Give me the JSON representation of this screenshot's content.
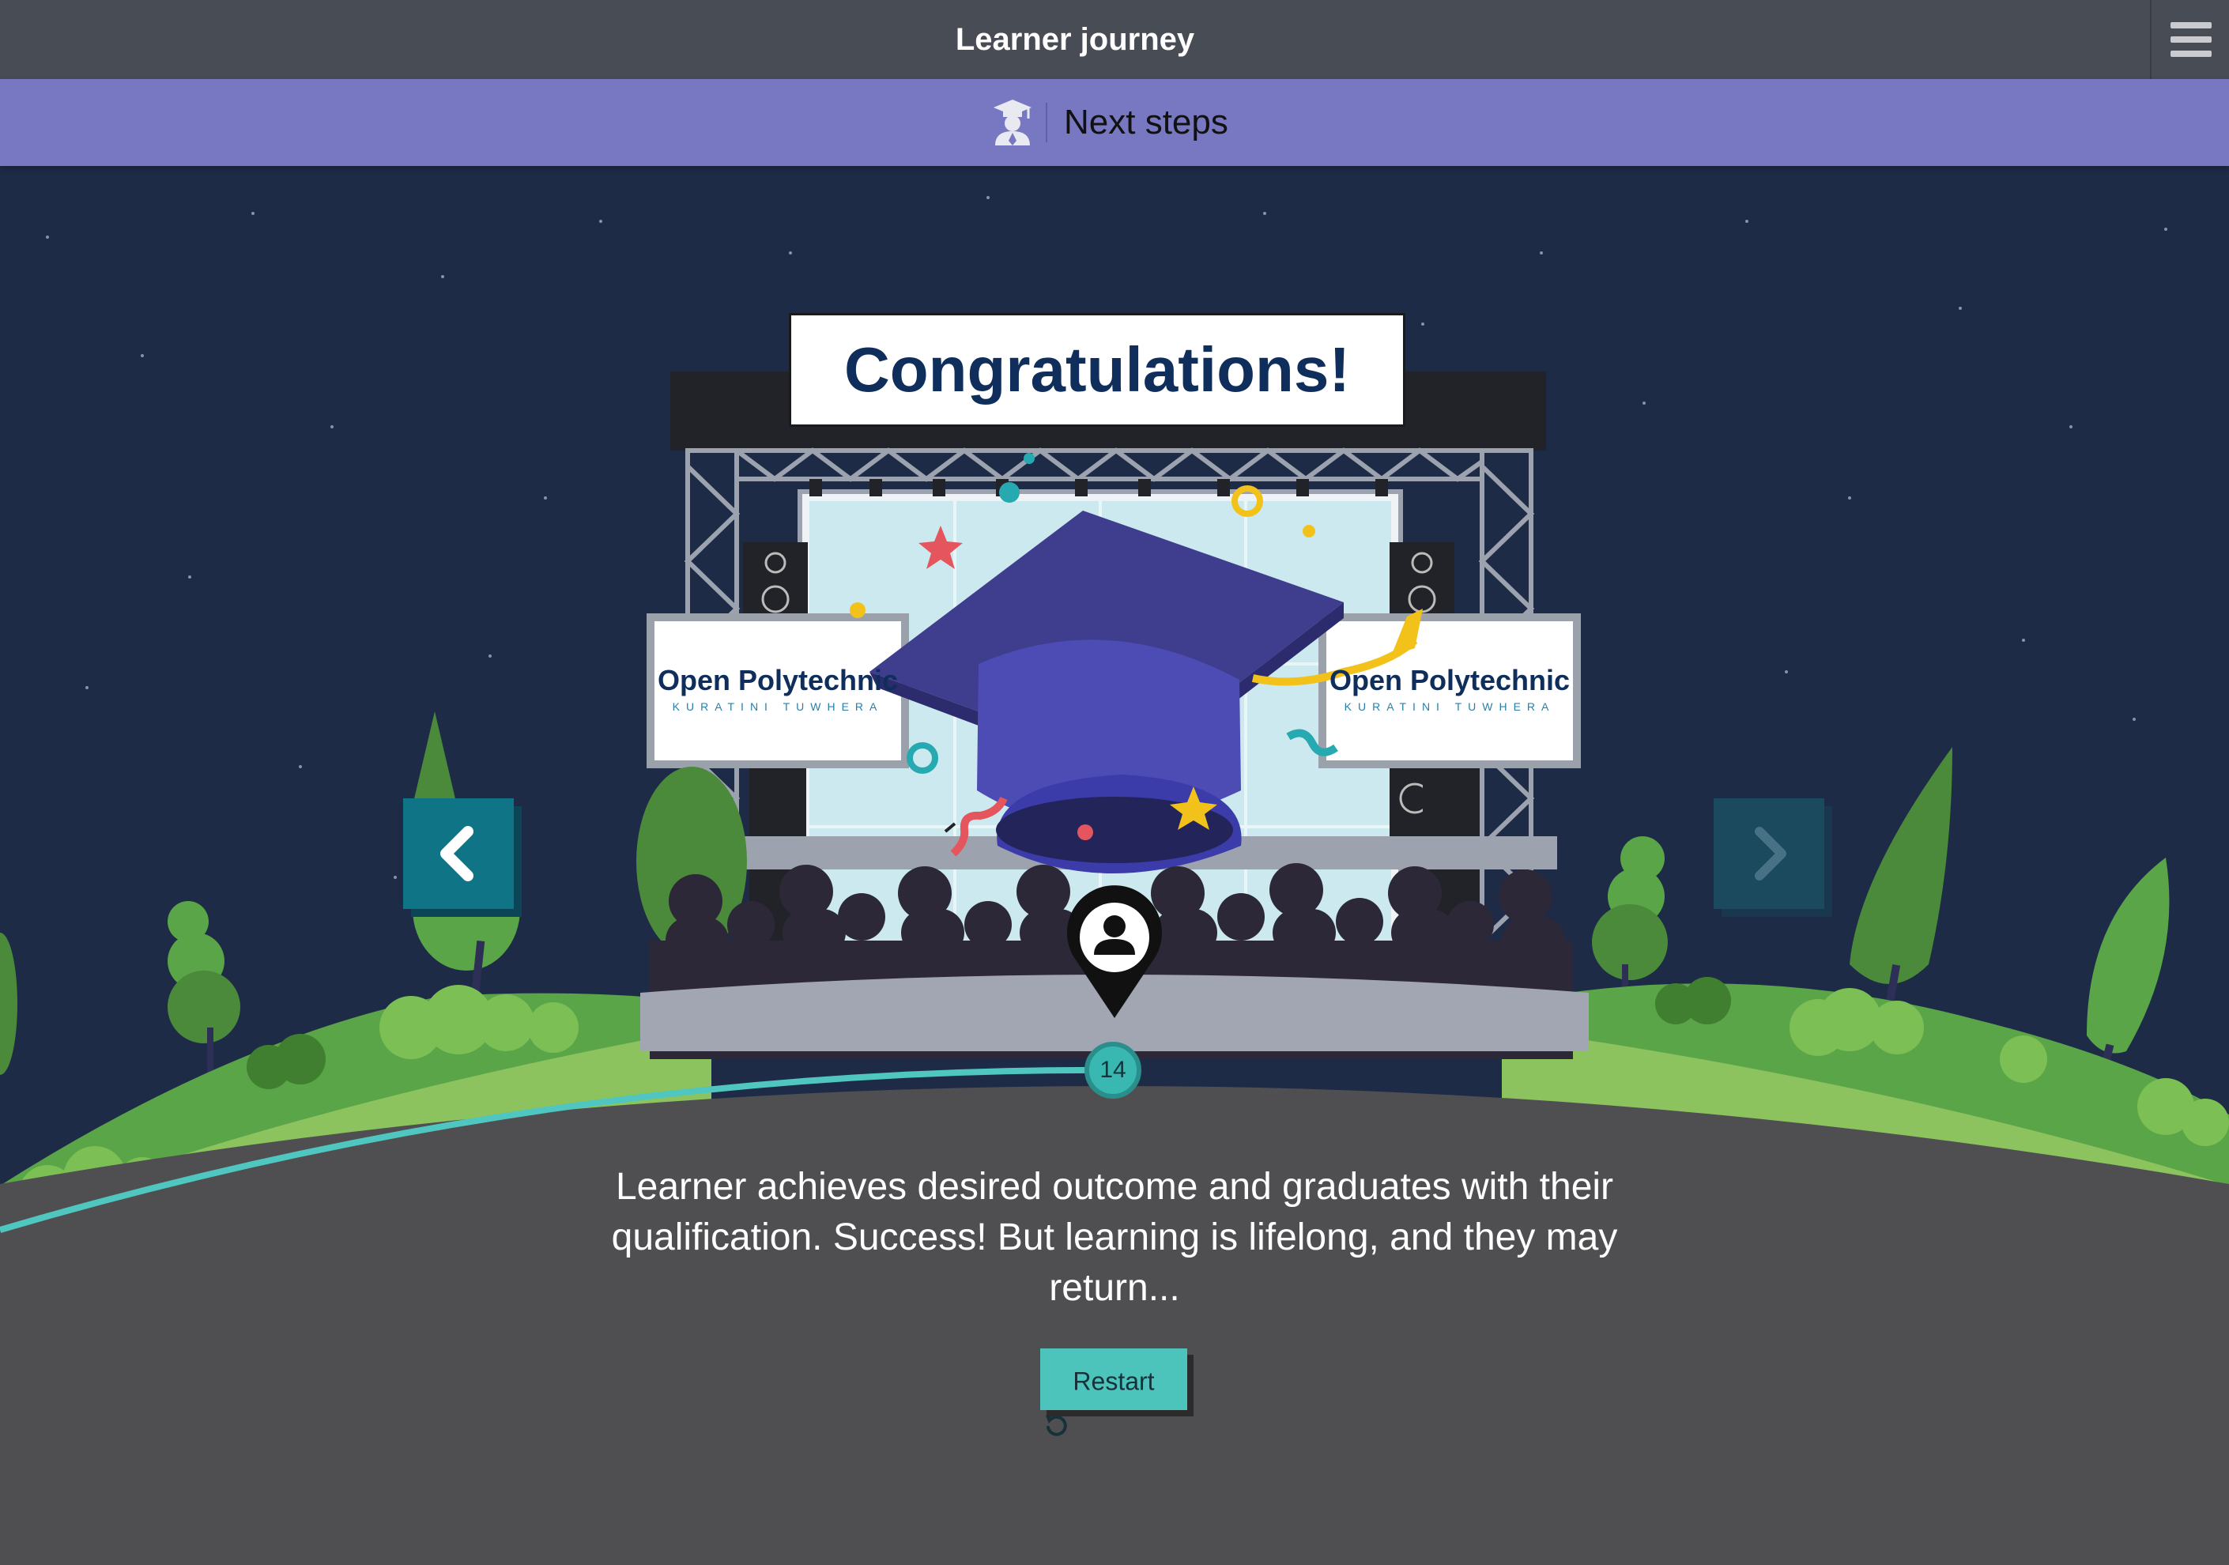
{
  "header": {
    "title": "Learner journey",
    "menu_icon": "hamburger-menu-icon"
  },
  "section": {
    "icon": "graduate-icon",
    "label": "Next steps"
  },
  "banner": {
    "text": "Congratulations!"
  },
  "screens": {
    "left": {
      "logo_name": "Open Polytechnic",
      "logo_sub": "KURATINI TUWHERA"
    },
    "right": {
      "logo_name": "Open Polytechnic",
      "logo_sub": "KURATINI TUWHERA"
    }
  },
  "navigation": {
    "prev_icon": "chevron-left-icon",
    "next_icon": "chevron-right-icon"
  },
  "step": {
    "number": "14",
    "marker_icon": "person-location-pin-icon"
  },
  "description": "Learner achieves desired outcome and graduates with their qualification. Success! But learning is lifelong, and they may return...",
  "restart": {
    "label": "Restart",
    "icon": "restart-icon"
  },
  "colors": {
    "topbar": "#484c55",
    "subbar": "#7777c2",
    "night_sky": "#1e2b47",
    "road": "#4f4f51",
    "grass": "#8cc35e",
    "path_line": "#4fc6c0",
    "nav_active": "#0f7486",
    "restart_button": "#4cc4bb"
  }
}
